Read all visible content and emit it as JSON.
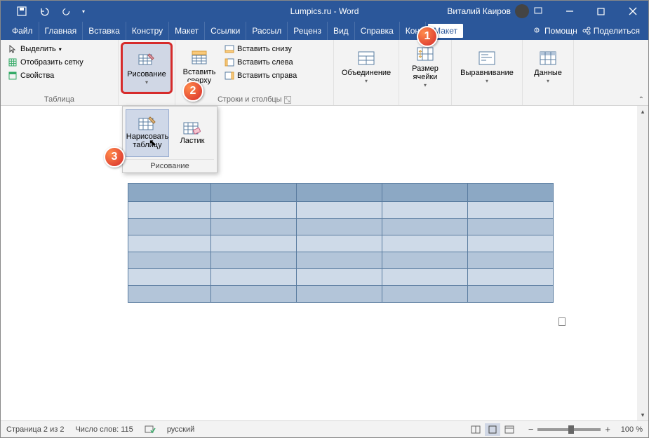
{
  "titlebar": {
    "title": "Lumpics.ru - Word",
    "user": "Виталий Каиров"
  },
  "tabs": {
    "file": "Файл",
    "home": "Главная",
    "insert": "Вставка",
    "design": "Констру",
    "layout": "Макет",
    "refs": "Ссылки",
    "mail": "Рассыл",
    "review": "Реценз",
    "view": "Вид",
    "help": "Справка",
    "tdesign": "Кон",
    "tlayout": "Макет",
    "assist": "Помощн",
    "share": "Поделиться"
  },
  "ribbon": {
    "table": {
      "select": "Выделить",
      "grid": "Отобразить сетку",
      "props": "Свойства",
      "label": "Таблица"
    },
    "draw": {
      "button": "Рисование",
      "panel_title": "Рисование",
      "draw_table": "Нарисовать таблицу",
      "eraser": "Ластик"
    },
    "rowscols": {
      "insert_above": "Вставить сверху",
      "insert_below": "Вставить снизу",
      "insert_left": "Вставить слева",
      "insert_right": "Вставить справа",
      "label": "Строки и столбцы"
    },
    "merge": {
      "label": "Объединение"
    },
    "cellsize": {
      "label": "Размер ячейки"
    },
    "align": {
      "label": "Выравнивание"
    },
    "data": {
      "label": "Данные"
    }
  },
  "badges": {
    "b1": "1",
    "b2": "2",
    "b3": "3"
  },
  "status": {
    "page": "Страница 2 из 2",
    "words": "Число слов: 115",
    "lang": "русский",
    "zoom": "100 %"
  },
  "table_cols": [
    118,
    122,
    122,
    122,
    122
  ]
}
